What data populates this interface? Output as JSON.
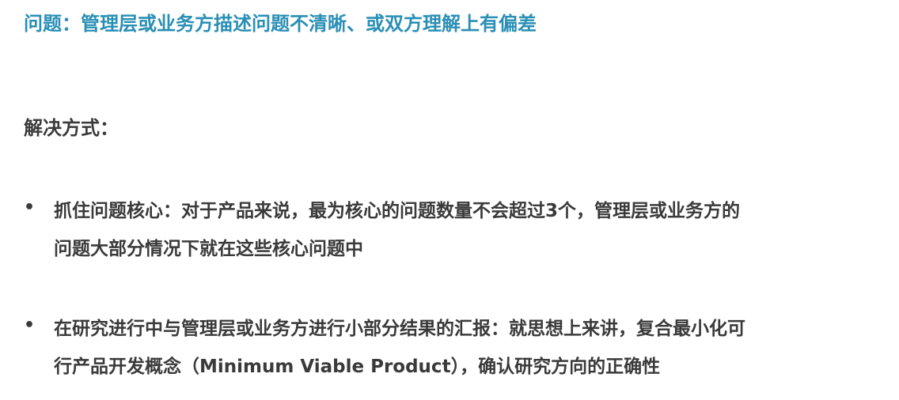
{
  "slide": {
    "title": "问题：管理层或业务方描述问题不清晰、或双方理解上有偏差",
    "section_heading": "解决方式：",
    "bullets": [
      {
        "marker": "•",
        "lines": [
          "抓住问题核心：对于产品来说，最为核心的问题数量不会超过3个，管理层或业务方的",
          "问题大部分情况下就在这些核心问题中"
        ]
      },
      {
        "marker": "•",
        "lines": [
          "在研究进行中与管理层或业务方进行小部分结果的汇报：就思想上来讲，复合最小化可",
          "行产品开发概念（Minimum Viable Product），确认研究方向的正确性"
        ]
      }
    ],
    "colors": {
      "title": "#2a8fb5",
      "body": "#3a3a3a",
      "background": "#ffffff"
    }
  }
}
